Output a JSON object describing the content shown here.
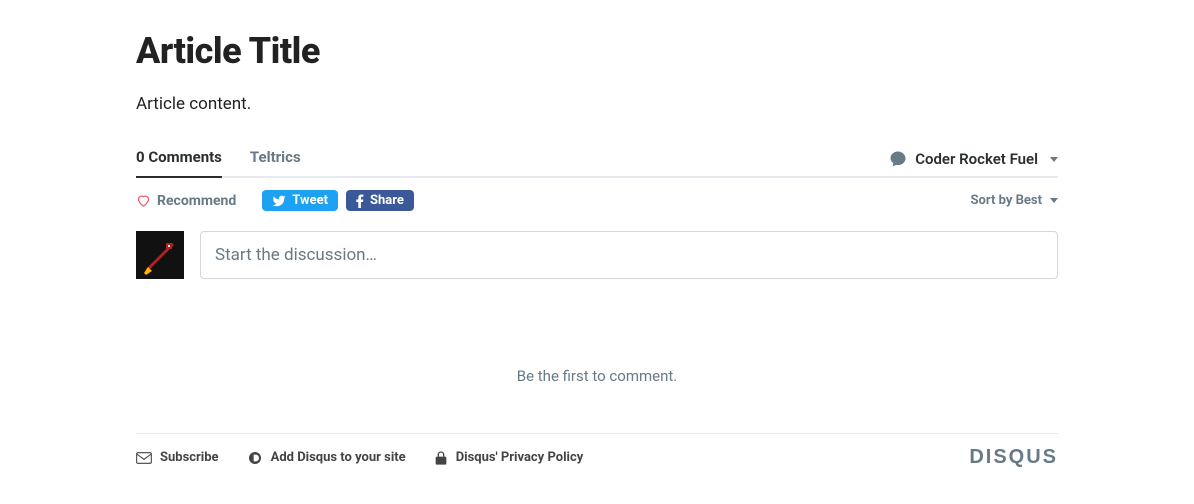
{
  "article": {
    "title": "Article Title",
    "content": "Article content."
  },
  "tabs": {
    "comments_count": "0 Comments",
    "community": "Teltrics"
  },
  "user": {
    "name": "Coder Rocket Fuel"
  },
  "actions": {
    "recommend": "Recommend",
    "tweet": "Tweet",
    "share": "Share",
    "sortby": "Sort by Best"
  },
  "compose": {
    "placeholder": "Start the discussion…"
  },
  "empty_message": "Be the first to comment.",
  "footer": {
    "subscribe": "Subscribe",
    "add_disqus": "Add Disqus to your site",
    "privacy": "Disqus' Privacy Policy",
    "brand": "DISQUS"
  }
}
